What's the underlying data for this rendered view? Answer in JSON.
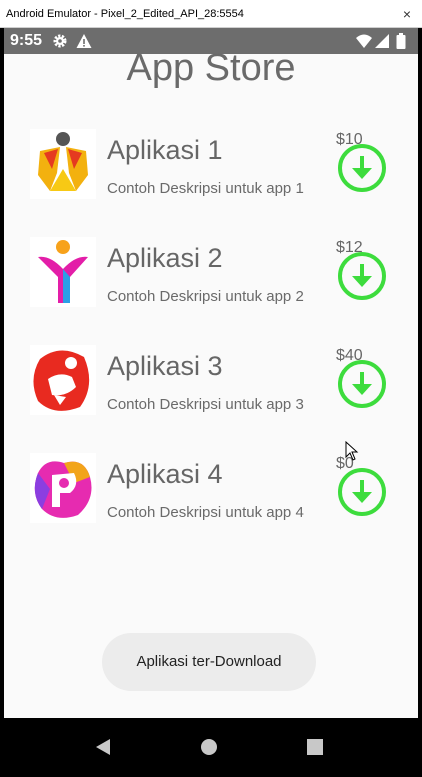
{
  "window": {
    "title": "Android Emulator - Pixel_2_Edited_API_28:5554",
    "close_glyph": "×"
  },
  "statusbar": {
    "time": "9:55",
    "icons": [
      "gear-icon",
      "warning-icon",
      "wifi-icon",
      "signal-icon",
      "battery-icon"
    ]
  },
  "page": {
    "title": "App Store"
  },
  "apps": [
    {
      "name": "Aplikasi 1",
      "description": "Contoh Deskripsi untuk app 1",
      "price": "$10",
      "icon": "app-1-logo"
    },
    {
      "name": "Aplikasi 2",
      "description": "Contoh Deskripsi untuk app 2",
      "price": "$12",
      "icon": "app-2-logo"
    },
    {
      "name": "Aplikasi 3",
      "description": "Contoh Deskripsi untuk app 3",
      "price": "$40",
      "icon": "app-3-logo"
    },
    {
      "name": "Aplikasi 4",
      "description": "Contoh Deskripsi untuk app 4",
      "price": "$0",
      "icon": "app-4-logo"
    }
  ],
  "toast": {
    "message": "Aplikasi ter-Download"
  },
  "colors": {
    "download_green": "#3ddc3d",
    "statusbar_bg": "#6d6d6d"
  },
  "navbar": {
    "buttons": [
      "back-icon",
      "home-icon",
      "recents-icon"
    ]
  }
}
